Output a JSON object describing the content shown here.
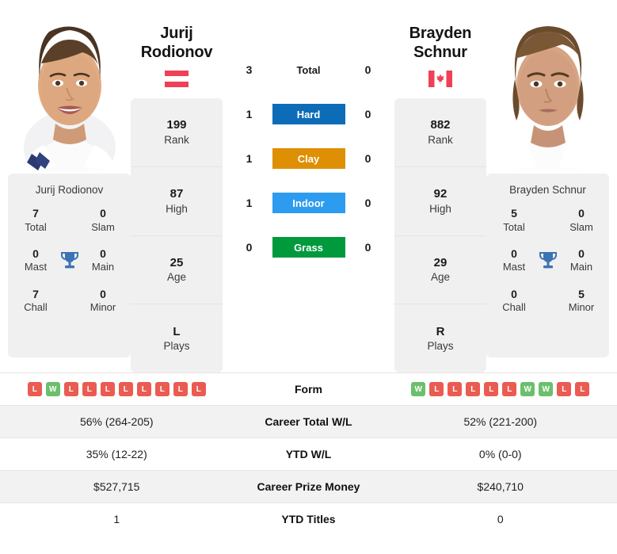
{
  "players": {
    "left": {
      "first_name": "Jurij",
      "last_name": "Rodionov",
      "full_name": "Jurij Rodionov",
      "country": "Austria",
      "flag": "austria-flag",
      "stats": [
        {
          "value": "199",
          "label": "Rank"
        },
        {
          "value": "87",
          "label": "High"
        },
        {
          "value": "25",
          "label": "Age"
        },
        {
          "value": "L",
          "label": "Plays"
        }
      ],
      "titles": [
        {
          "left_value": "7",
          "left_label": "Total",
          "right_value": "0",
          "right_label": "Slam"
        },
        {
          "left_value": "0",
          "left_label": "Mast",
          "right_value": "0",
          "right_label": "Main"
        },
        {
          "left_value": "7",
          "left_label": "Chall",
          "right_value": "0",
          "right_label": "Minor"
        }
      ],
      "form": [
        "L",
        "W",
        "L",
        "L",
        "L",
        "L",
        "L",
        "L",
        "L",
        "L"
      ],
      "career_total_wl": "56% (264-205)",
      "ytd_wl": "35% (12-22)",
      "career_prize_money": "$527,715",
      "ytd_titles": "1"
    },
    "right": {
      "first_name": "Brayden",
      "last_name": "Schnur",
      "full_name": "Brayden Schnur",
      "country": "Canada",
      "flag": "canada-flag",
      "stats": [
        {
          "value": "882",
          "label": "Rank"
        },
        {
          "value": "92",
          "label": "High"
        },
        {
          "value": "29",
          "label": "Age"
        },
        {
          "value": "R",
          "label": "Plays"
        }
      ],
      "titles": [
        {
          "left_value": "5",
          "left_label": "Total",
          "right_value": "0",
          "right_label": "Slam"
        },
        {
          "left_value": "0",
          "left_label": "Mast",
          "right_value": "0",
          "right_label": "Main"
        },
        {
          "left_value": "0",
          "left_label": "Chall",
          "right_value": "5",
          "right_label": "Minor"
        }
      ],
      "form": [
        "W",
        "L",
        "L",
        "L",
        "L",
        "L",
        "W",
        "W",
        "L",
        "L"
      ],
      "career_total_wl": "52% (221-200)",
      "ytd_wl": "0% (0-0)",
      "career_prize_money": "$240,710",
      "ytd_titles": "0"
    }
  },
  "head_to_head": [
    {
      "surface": "Total",
      "left": "3",
      "right": "0",
      "color": "",
      "style": "plain"
    },
    {
      "surface": "Hard",
      "left": "1",
      "right": "0",
      "color": "#0c6cb8",
      "style": "badge"
    },
    {
      "surface": "Clay",
      "left": "1",
      "right": "0",
      "color": "#df8f04",
      "style": "badge"
    },
    {
      "surface": "Indoor",
      "left": "1",
      "right": "0",
      "color": "#2d9cf0",
      "style": "badge"
    },
    {
      "surface": "Grass",
      "left": "0",
      "right": "0",
      "color": "#009a3d",
      "style": "badge"
    }
  ],
  "table_rows": [
    {
      "label": "Form",
      "type": "form"
    },
    {
      "label": "Career Total W/L",
      "type": "text",
      "key": "career_total_wl"
    },
    {
      "label": "YTD W/L",
      "type": "text",
      "key": "ytd_wl"
    },
    {
      "label": "Career Prize Money",
      "type": "text",
      "key": "career_prize_money"
    },
    {
      "label": "YTD Titles",
      "type": "text",
      "key": "ytd_titles"
    }
  ],
  "colors": {
    "hard": "#0c6cb8",
    "clay": "#df8f04",
    "indoor": "#2d9cf0",
    "grass": "#009a3d",
    "win": "#6cbf6c",
    "loss": "#ea5b51",
    "trophy": "#3d72b4",
    "card_bg": "#f0f0f0"
  }
}
